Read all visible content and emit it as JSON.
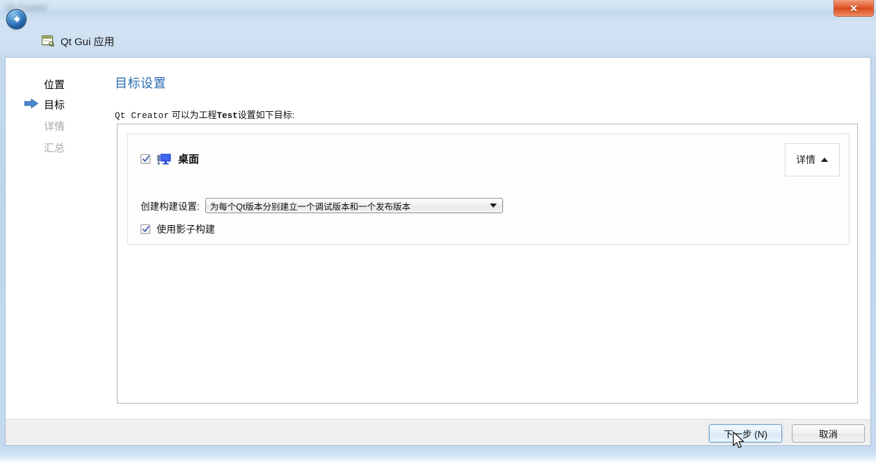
{
  "window": {
    "titlebar_text": "Qt Creator",
    "close_label": "✕"
  },
  "header": {
    "back_icon": "back-arrow-icon",
    "wizard_icon": "qt-gui-form-icon",
    "title": "Qt Gui 应用"
  },
  "sidebar": {
    "items": [
      {
        "label": "位置",
        "state": "done"
      },
      {
        "label": "目标",
        "state": "active"
      },
      {
        "label": "详情",
        "state": "pending"
      },
      {
        "label": "汇总",
        "state": "pending"
      }
    ],
    "current_arrow_icon": "right-arrow-icon"
  },
  "page": {
    "title": "目标设置",
    "desc_prefix": "Qt Creator",
    "desc_middle": " 可以为工程",
    "desc_project": "Test",
    "desc_suffix": "设置如下目标:"
  },
  "kit": {
    "checkbox_checked": true,
    "icon": "desktop-monitor-icon",
    "name": "桌面",
    "details_button_label": "详情",
    "details_button_icon": "chevron-up-icon",
    "build_settings_label": "创建构建设置:",
    "build_settings_value": "为每个Qt版本分别建立一个调试版本和一个发布版本",
    "build_settings_options": [
      "为每个Qt版本分别建立一个调试版本和一个发布版本"
    ],
    "shadow_build_checked": true,
    "shadow_build_label": "使用影子构建"
  },
  "footer": {
    "next_label": "下一步 (N)",
    "cancel_label": "取消"
  },
  "colors": {
    "accent_title": "#2b6cb0",
    "close_red": "#e2572a",
    "pending_text": "#a8a8a8",
    "footer_bg": "#efefef"
  }
}
